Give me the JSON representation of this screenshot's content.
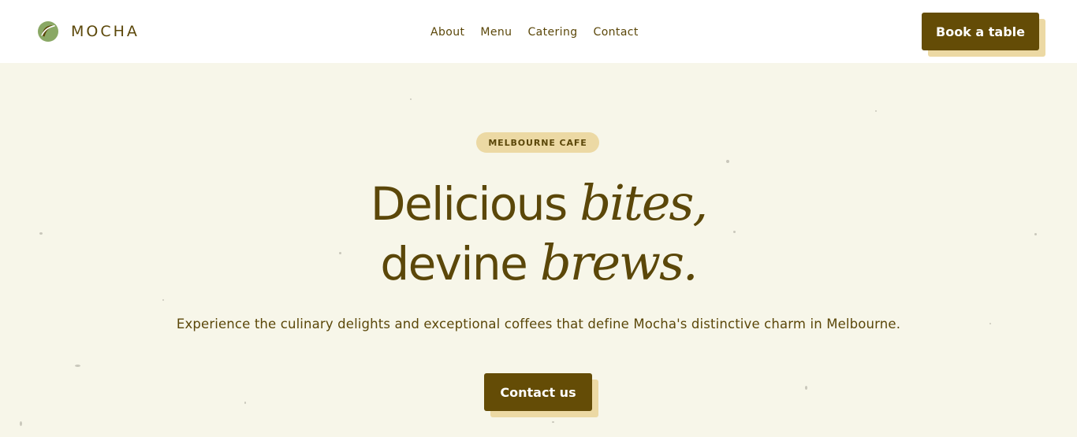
{
  "brand": {
    "name": "MOCHA",
    "logo_icon": "leaf-circle-logo"
  },
  "nav": {
    "items": [
      {
        "label": "About"
      },
      {
        "label": "Menu"
      },
      {
        "label": "Catering"
      },
      {
        "label": "Contact"
      }
    ]
  },
  "header": {
    "cta_label": "Book a table"
  },
  "hero": {
    "badge": "MELBOURNE CAFE",
    "headline": {
      "line1_plain": "Delicious ",
      "line1_italic": "bites,",
      "line2_plain": "devine ",
      "line2_italic": "brews."
    },
    "subtext": "Experience the culinary delights and exceptional coffees that define Mocha's distinctive charm in Melbourne.",
    "cta_label": "Contact us"
  },
  "colors": {
    "brand_brown": "#644c06",
    "text_brown": "#5b4709",
    "accent_tan": "#ecd9a4",
    "hero_background": "#f7f6e9",
    "logo_green": "#8aa865"
  }
}
